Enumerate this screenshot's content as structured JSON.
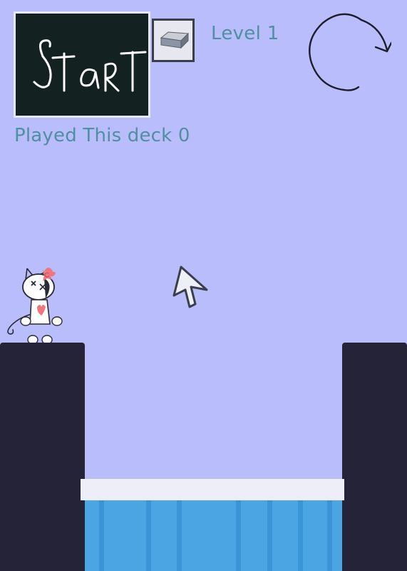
{
  "game": {
    "start_button": {
      "label": "START",
      "bg_color": "#142121",
      "text_color": "#ffffff"
    },
    "deck_button": {
      "icon": "card-deck-icon"
    },
    "level_label": "Level 1",
    "played_label": "Played This deck 0",
    "restart_button": {
      "icon": "restart-arrow-icon"
    },
    "cursor": {
      "icon": "pointer-arrow-icon"
    },
    "player": {
      "icon": "cat-character-icon",
      "bow_color": "#f0757c",
      "heart_color": "#f0757c"
    },
    "colors": {
      "sky": "#babdfb",
      "label_text": "#4f8fa2",
      "platform": "#252338",
      "water": "#4aa5e2",
      "water_stripe": "#3a95d6",
      "water_cap": "#edeef7"
    }
  }
}
